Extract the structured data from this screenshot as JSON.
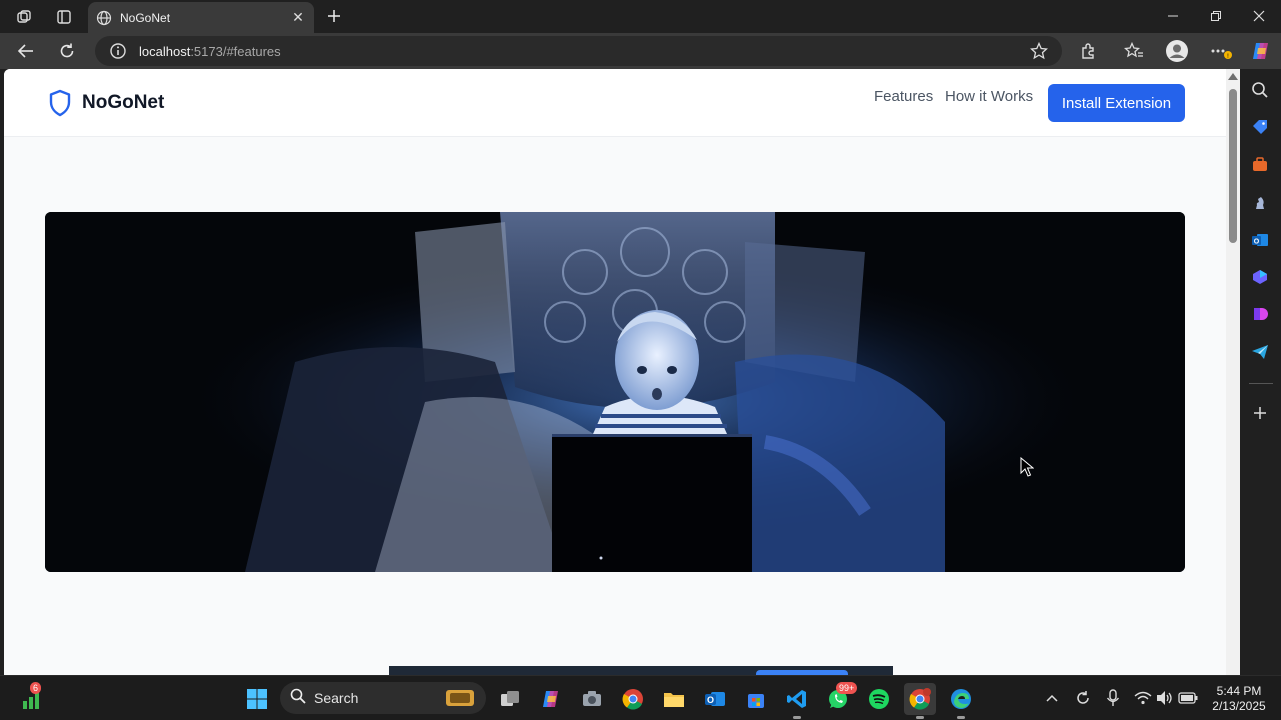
{
  "browser": {
    "tab_title": "NoGoNet",
    "url_host": "localhost",
    "url_rest": ":5173/#features",
    "window_controls": [
      "minimize-icon",
      "restore-icon",
      "close-icon"
    ]
  },
  "site": {
    "brand": "NoGoNet",
    "nav": [
      {
        "label": "Features"
      },
      {
        "label": "How it Works"
      }
    ],
    "cta_label": "Install Extension",
    "accent": "#2563eb",
    "hero_image": "child-laptop-at-night"
  },
  "taskbar": {
    "search_label": "Search",
    "widget_badge": "6",
    "whatsapp_badge": "99+",
    "time": "5:44 PM",
    "date": "2/13/2025"
  },
  "colors": {
    "tab_bg": "#3a3a3a",
    "chrome_bg": "#202020",
    "page_bg": "#f9fafb",
    "button": "#2563eb"
  }
}
